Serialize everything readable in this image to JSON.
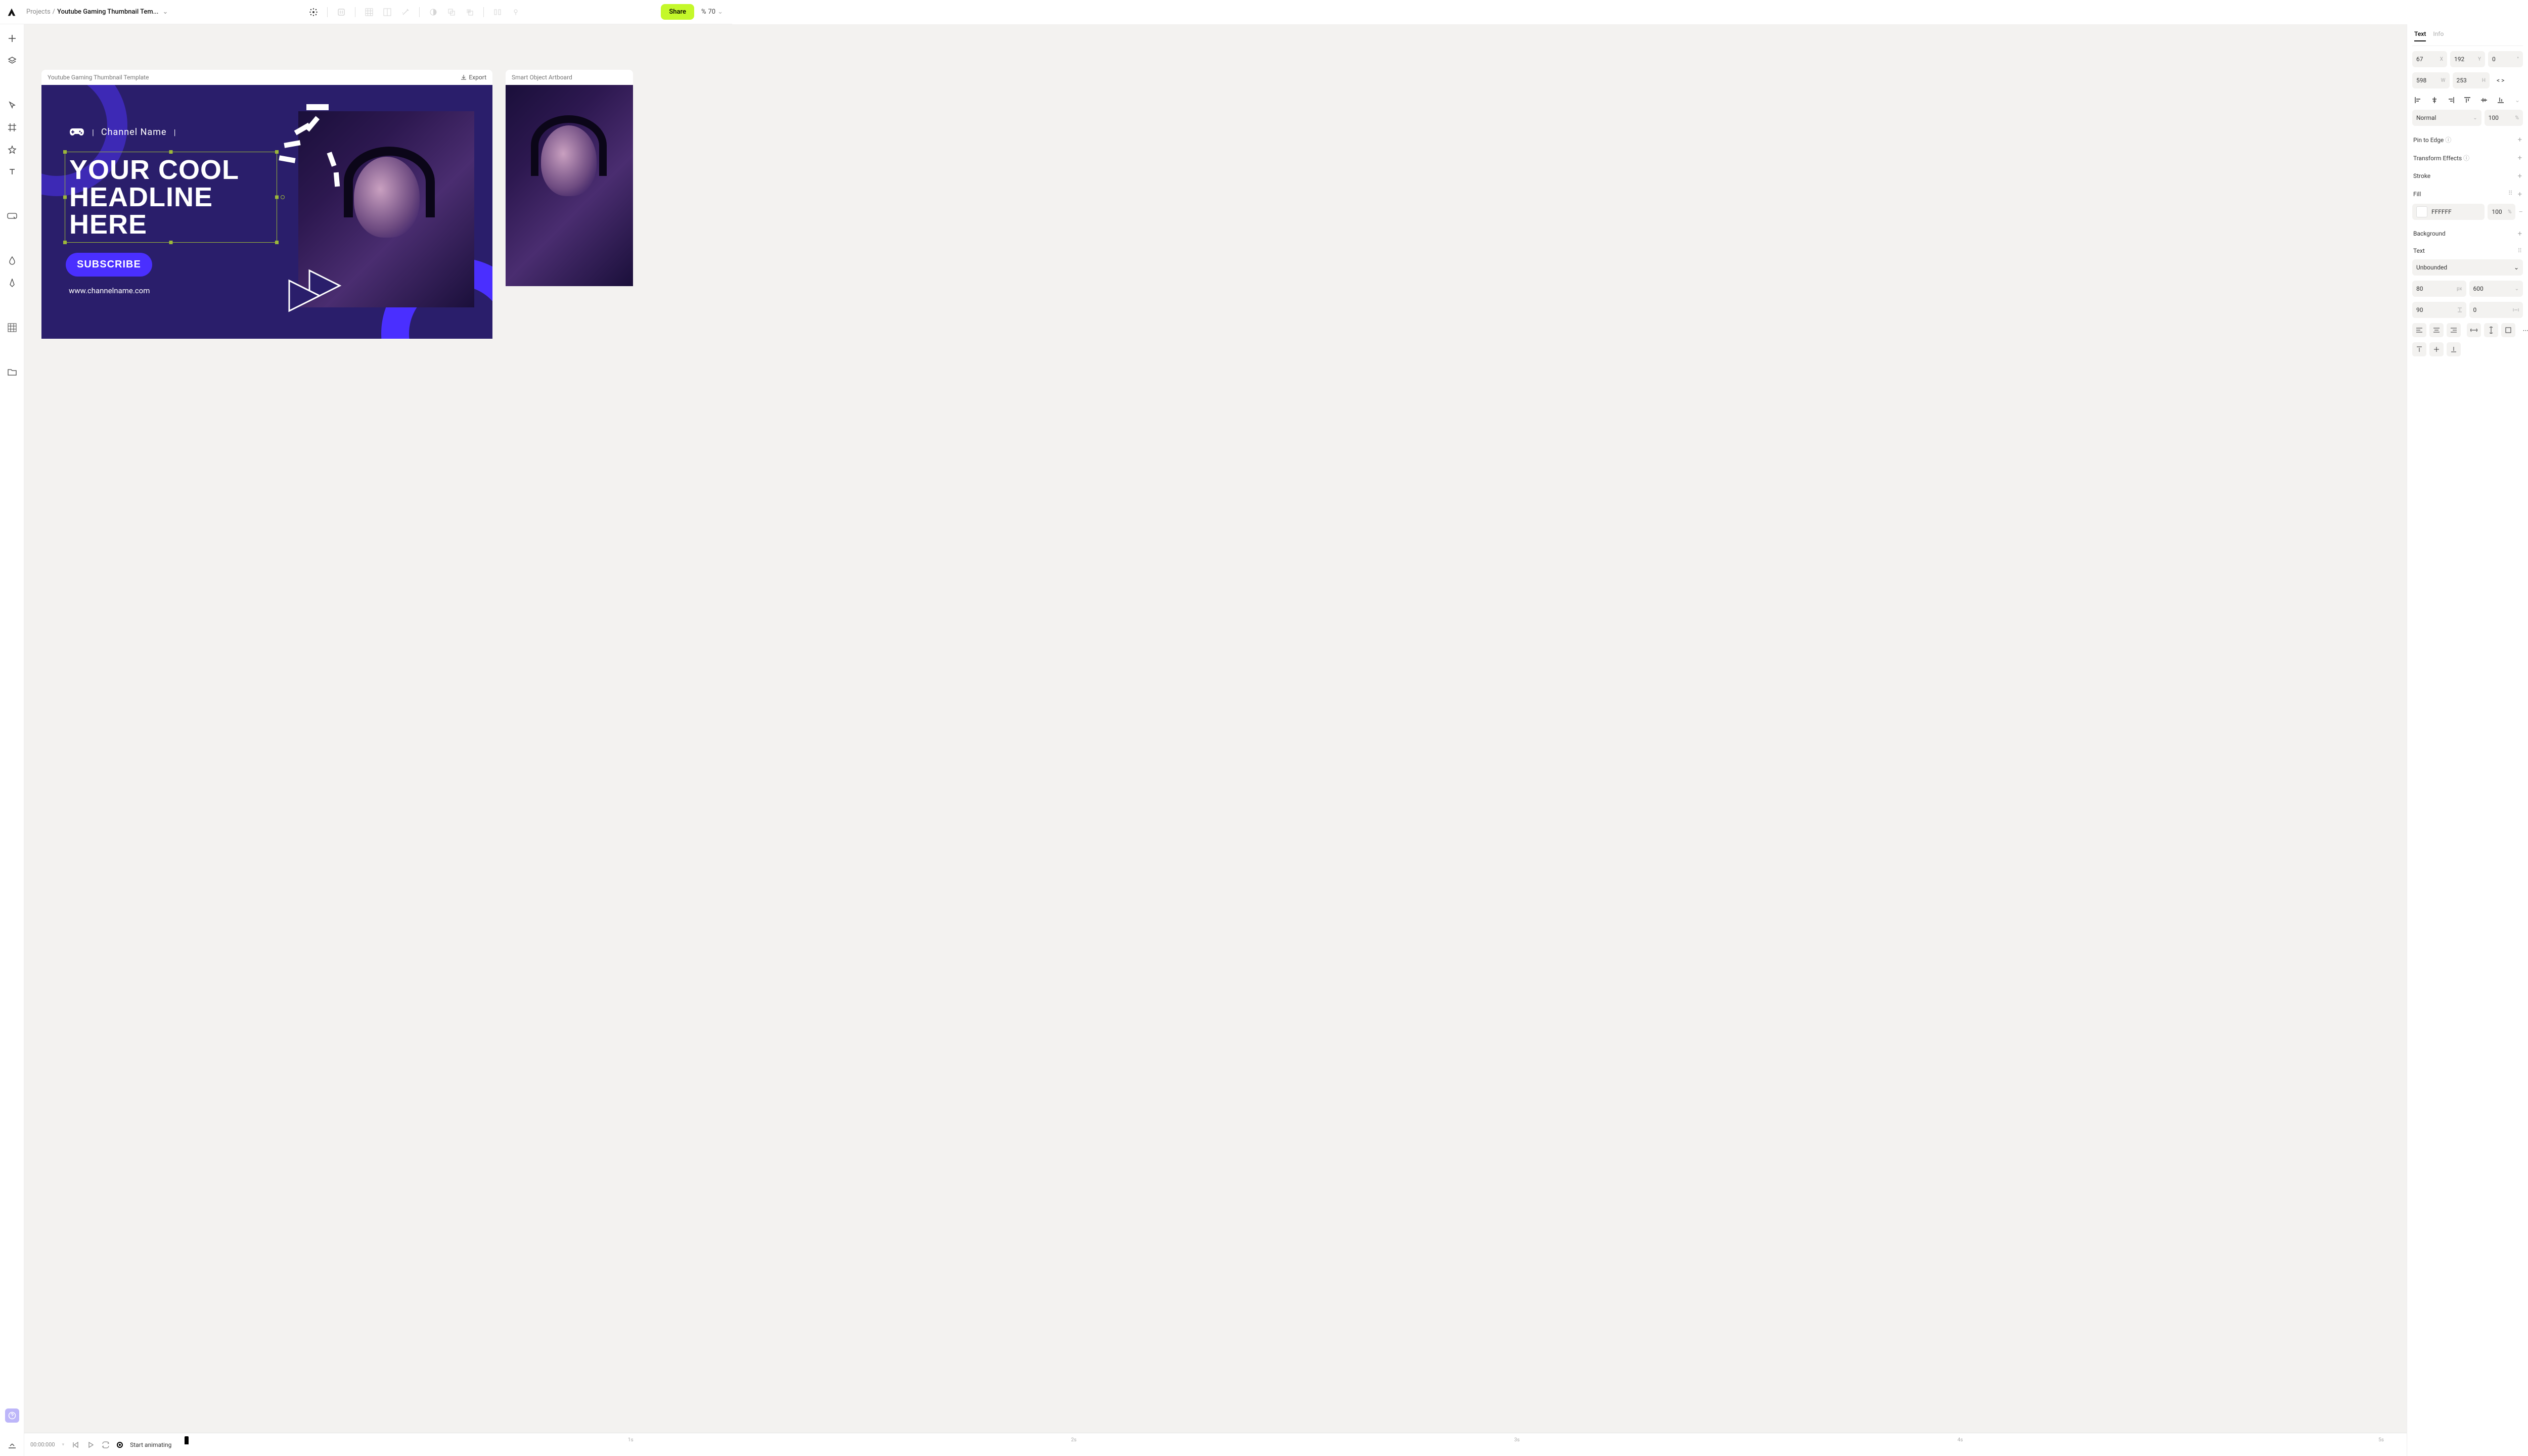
{
  "breadcrumb": {
    "root": "Projects",
    "sep": "/",
    "current": "Youtube Gaming Thumbnail Tem..."
  },
  "topbar": {
    "share": "Share",
    "zoom_prefix": "%",
    "zoom": "70"
  },
  "artboard1": {
    "title": "Youtube Gaming Thumbnail Template",
    "export": "Export",
    "channel_name": "Channel Name",
    "headline": "YOUR COOL HEADLINE HERE",
    "subscribe": "SUBSCRIBE",
    "website": "www.channelname.com"
  },
  "artboard2": {
    "title": "Smart Object Artboard"
  },
  "timeline": {
    "timecode": "00:00:000",
    "label": "Start animating",
    "marks": [
      "1s",
      "2s",
      "3s",
      "4s",
      "5s"
    ]
  },
  "panel": {
    "tabs": [
      "Text",
      "Info"
    ],
    "x": "67",
    "y": "192",
    "rot": "0",
    "w": "598",
    "h": "253",
    "aspect": "< >",
    "blend": "Normal",
    "opacity": "100",
    "pin_label": "Pin to Edge",
    "transform_label": "Transform Effects",
    "stroke_label": "Stroke",
    "fill_label": "Fill",
    "fill_hex": "FFFFFF",
    "fill_opacity": "100",
    "bg_label": "Background",
    "text_label": "Text",
    "font": "Unbounded",
    "font_size": "80",
    "font_weight": "600",
    "line_height": "90",
    "letter": "0"
  }
}
